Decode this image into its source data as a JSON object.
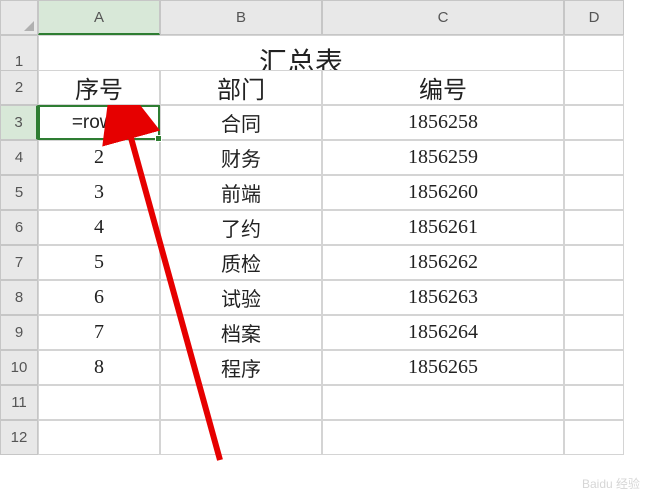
{
  "columns": [
    "A",
    "B",
    "C",
    "D"
  ],
  "rows": [
    "1",
    "2",
    "3",
    "4",
    "5",
    "6",
    "7",
    "8",
    "9",
    "10",
    "11",
    "12"
  ],
  "title": "汇总表",
  "headers": {
    "colA": "序号",
    "colB": "部门",
    "colC": "编号"
  },
  "active_cell": {
    "ref": "A3",
    "formula": "=row()"
  },
  "data": [
    {
      "seq": "=row()",
      "dept": "合同",
      "code": "1856258"
    },
    {
      "seq": "2",
      "dept": "财务",
      "code": "1856259"
    },
    {
      "seq": "3",
      "dept": "前端",
      "code": "1856260"
    },
    {
      "seq": "4",
      "dept": "了约",
      "code": "1856261"
    },
    {
      "seq": "5",
      "dept": "质检",
      "code": "1856262"
    },
    {
      "seq": "6",
      "dept": "试验",
      "code": "1856263"
    },
    {
      "seq": "7",
      "dept": "档案",
      "code": "1856264"
    },
    {
      "seq": "8",
      "dept": "程序",
      "code": "1856265"
    }
  ],
  "arrow_color": "#e60000",
  "watermark": "Baidu 经验"
}
